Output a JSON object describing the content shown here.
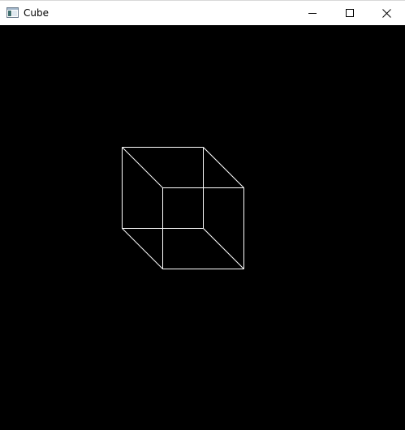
{
  "window": {
    "title": "Cube",
    "icon": "app-window-icon",
    "controls": {
      "minimize_icon": "minimize-icon",
      "maximize_icon": "maximize-icon",
      "close_icon": "close-icon"
    }
  },
  "canvas": {
    "background": "#000000",
    "stroke_color": "#ffffff",
    "content": "wireframe-cube"
  }
}
